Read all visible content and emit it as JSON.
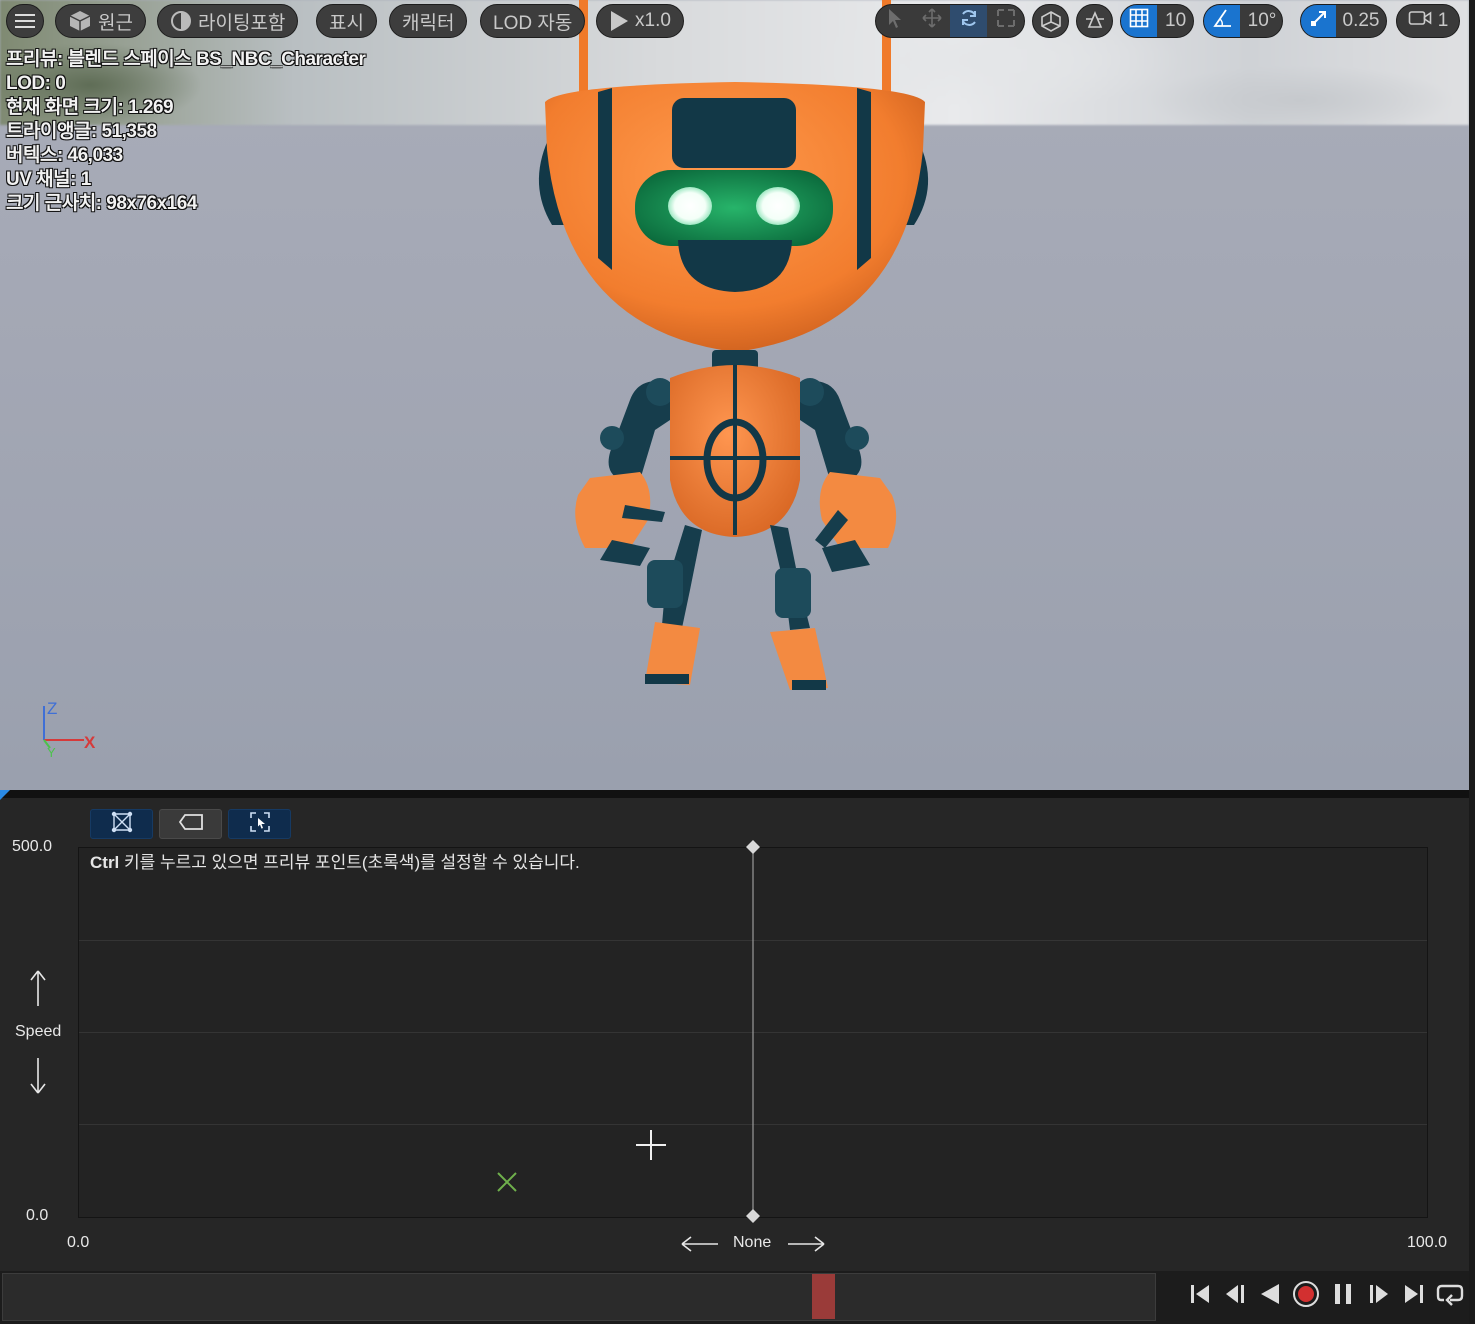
{
  "toolbar": {
    "perspective_label": "원근",
    "lighting_label": "라이팅포함",
    "show_label": "표시",
    "character_label": "캐릭터",
    "lod_label": "LOD 자동",
    "play_speed_label": "x1.0",
    "grid_snap_value": "10",
    "rotation_snap_value": "10°",
    "scale_snap_value": "0.25",
    "camera_speed_value": "1",
    "accent_color": "#1a74cf"
  },
  "stats": {
    "preview": "프리뷰: 블렌드 스페이스 BS_NBC_Character",
    "lod": "LOD: 0",
    "screen_size": "현재 화면 크기: 1.269",
    "triangles": "트라이앵글: 51,358",
    "vertices": "버텍스: 46,033",
    "uv_channels": "UV 채널: 1",
    "approx_size": "크기 근사치: 98x76x164"
  },
  "gizmo": {
    "z": "Z",
    "x": "X",
    "y": "Y"
  },
  "blendspace": {
    "hint_bold": "Ctrl",
    "hint_rest": " 키를 누르고 있으면 프리뷰 포인트(초록색)를 설정할 수 있습니다.",
    "y_max": "500.0",
    "y_min": "0.0",
    "y_axis_name": "Speed",
    "x_min": "0.0",
    "x_max": "100.0",
    "x_axis_name": "None"
  }
}
